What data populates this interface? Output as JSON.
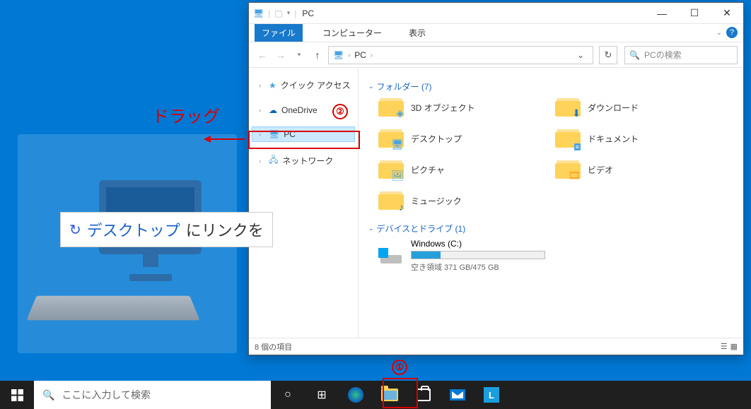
{
  "annotations": {
    "drag_label": "ドラッグ",
    "hint_prefix": "デスクトップ",
    "hint_suffix": "にリンクを",
    "circle1": "①",
    "circle2": "②"
  },
  "explorer": {
    "title": "PC",
    "ribbon": {
      "file": "ファイル",
      "computer": "コンピューター",
      "view": "表示"
    },
    "breadcrumb": "PC",
    "search_placeholder": "PCの検索",
    "tree": {
      "quick_access": "クイック アクセス",
      "onedrive": "OneDrive",
      "pc": "PC",
      "network": "ネットワーク"
    },
    "groups": {
      "folders": "フォルダー (7)",
      "devices": "デバイスとドライブ (1)"
    },
    "folders": {
      "objects3d": "3D オブジェクト",
      "downloads": "ダウンロード",
      "desktop": "デスクトップ",
      "documents": "ドキュメント",
      "pictures": "ピクチャ",
      "videos": "ビデオ",
      "music": "ミュージック"
    },
    "drive": {
      "name": "Windows (C:)",
      "free": "空き領域 371 GB/475 GB"
    },
    "status": "8 個の項目"
  },
  "taskbar": {
    "search_placeholder": "ここに入力して検索",
    "l_label": "L"
  }
}
